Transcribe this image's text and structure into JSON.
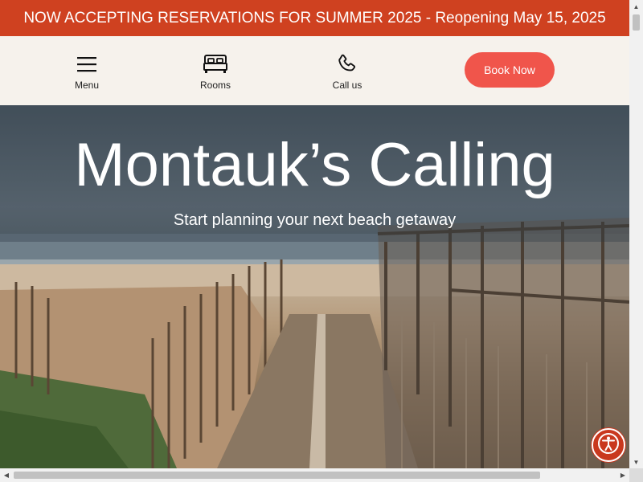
{
  "announcement": {
    "text": "NOW ACCEPTING RESERVATIONS FOR SUMMER 2025 - Reopening May 15, 2025"
  },
  "header": {
    "menu_label": "Menu",
    "rooms_label": "Rooms",
    "call_label": "Call us",
    "book_label": "Book Now",
    "icons": {
      "menu": "hamburger-icon",
      "rooms": "bed-icon",
      "call": "phone-icon"
    }
  },
  "hero": {
    "title": "Montauk’s Calling",
    "subtitle": "Start planning your next beach getaway"
  },
  "accessibility": {
    "icon": "accessibility-icon"
  },
  "colors": {
    "announcement_bg": "#cf4120",
    "header_bg": "#f6f2ec",
    "book_button": "#f0554b",
    "accessibility_button": "#c9381e"
  }
}
